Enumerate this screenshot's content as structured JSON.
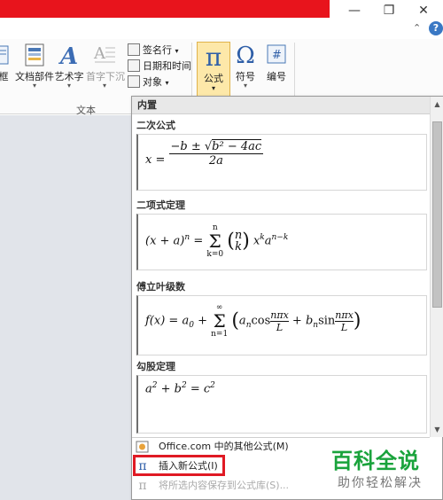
{
  "window": {
    "minimize": "—",
    "restore": "❐",
    "close": "✕",
    "collapse": "⌃",
    "help": "?"
  },
  "ribbon": {
    "buttons": {
      "frame": "框",
      "doc_parts": "文档部件",
      "wordart": "艺术字",
      "dropcap": "首字下沉",
      "signature": "签名行",
      "datetime": "日期和时间",
      "object": "对象",
      "formula": "公式",
      "symbol": "符号",
      "number": "编号"
    },
    "group_text": "文本",
    "icons": {
      "formula": "π",
      "symbol": "Ω",
      "number": "#"
    },
    "accent": "#fde8a9"
  },
  "panel": {
    "header": "内置",
    "sections": [
      {
        "title": "二次公式",
        "eq_parts": [
          "x = ",
          "−b ± √",
          "b² − 4ac",
          "2a"
        ]
      },
      {
        "title": "二项式定理",
        "eq_parts": [
          "(x + a)",
          "n",
          " = ",
          "Σ",
          "n",
          "k=0",
          "(",
          "n",
          "k",
          ")",
          "x",
          "k",
          "a",
          "n−k"
        ]
      },
      {
        "title": "傅立叶级数",
        "eq_parts": [
          "f(x) = a",
          "0",
          " + ",
          "Σ",
          "∞",
          "n=1",
          "(",
          "a",
          "n",
          "cos",
          "nπx",
          "L",
          " + b",
          "n",
          "sin",
          "nπx",
          "L",
          ")"
        ]
      },
      {
        "title": "勾股定理",
        "eq_parts": [
          "a",
          "2",
          " + b",
          "2",
          " = c",
          "2"
        ]
      }
    ],
    "menu": [
      {
        "icon": "office-icon",
        "label": "Office.com 中的其他公式(M)"
      },
      {
        "icon": "pi-icon",
        "label": "插入新公式(I)"
      },
      {
        "icon": "save-formula-icon",
        "label": "将所选内容保存到公式库(S)..."
      }
    ]
  },
  "watermark": {
    "main": "百科全说",
    "sub": "助你轻松解决"
  }
}
